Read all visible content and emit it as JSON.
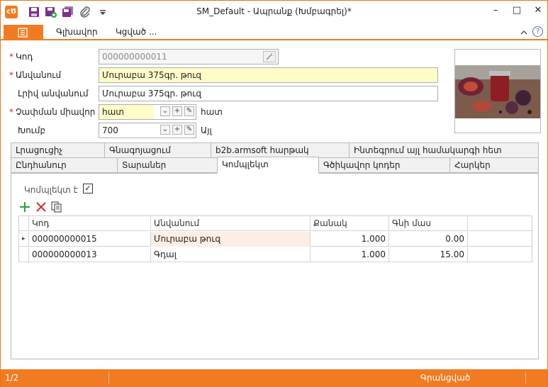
{
  "window": {
    "title": "SM_Default - Ապրանք (Խմբագրել)*",
    "app_logo": "cԾ",
    "minimize": "–",
    "maximize": "□",
    "close": "✕"
  },
  "menu": {
    "main_label": "Գլխավոր",
    "related_label": "Կցված ...",
    "help": "?"
  },
  "form": {
    "code_label": "Կոդ",
    "code_value": "000000000011",
    "name_label": "Անվանում",
    "name_value": "Մուրաբա 375գր. թուզ",
    "fullname_label": "Լրիվ անվանում",
    "fullname_value": "Մուրաբա 375գր. թուզ",
    "unit_label": "Չափման միավոր",
    "unit_value": "հատ",
    "unit_suffix": "հատ",
    "group_label": "Խումբ",
    "group_value": "700",
    "group_suffix": "Այլ",
    "required_mark": "*"
  },
  "tabs_row1": [
    {
      "label": "Լրացուցիչ"
    },
    {
      "label": "Գնագոյացում"
    },
    {
      "label": "b2b.armsoft հարթակ"
    },
    {
      "label": "Ինտեգրում այլ համակարգի հետ"
    }
  ],
  "tabs_row2": [
    {
      "label": "Ընդհանուր"
    },
    {
      "label": "Տարաներ"
    },
    {
      "label": "Կոմպլեկտ"
    },
    {
      "label": "Գծիկավոր կոդեր"
    },
    {
      "label": "Հարկեր"
    }
  ],
  "kit": {
    "is_kit_label": "Կոմպլեկտ է",
    "is_kit_checked": "✓"
  },
  "grid": {
    "headers": [
      "Կոդ",
      "Անվանում",
      "Քանակ",
      "Գնի մաս"
    ],
    "rows": [
      {
        "code": "000000000015",
        "name": "Մուրաբա թուզ",
        "qty": "1.000",
        "price_part": "0.00",
        "marker": "▸"
      },
      {
        "code": "000000000013",
        "name": "Գդալ",
        "qty": "1.000",
        "price_part": "15.00",
        "marker": ""
      }
    ]
  },
  "status": {
    "record": "1/2",
    "state": "Գրանցված"
  },
  "colors": {
    "accent": "#f07b22",
    "required": "#dd2222",
    "highlight_field": "#fffcc8"
  }
}
